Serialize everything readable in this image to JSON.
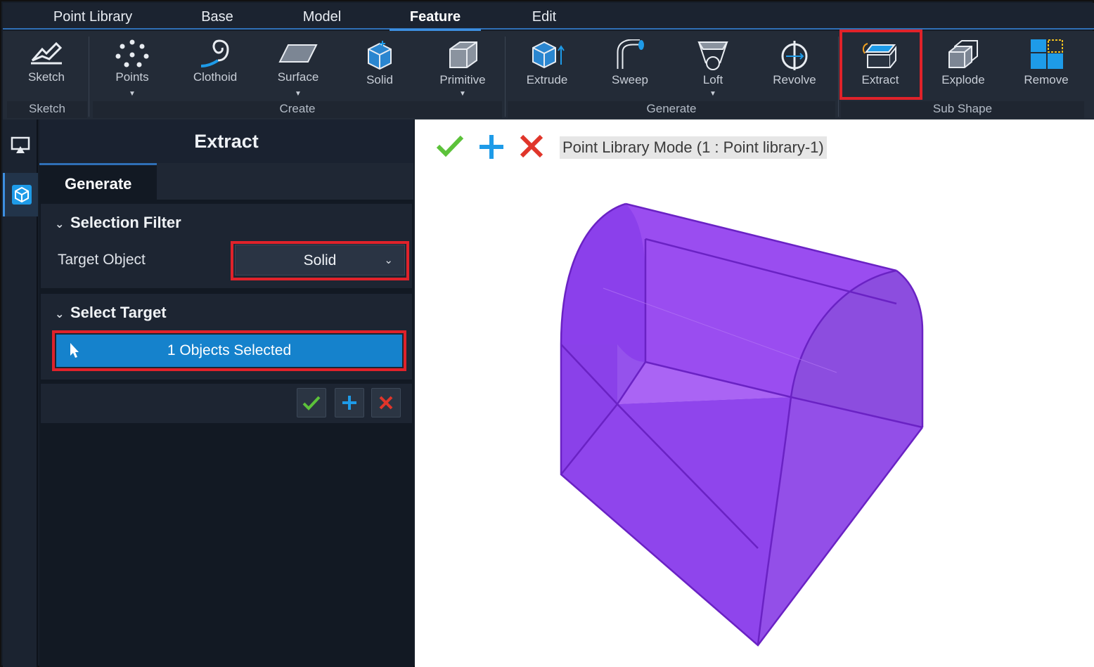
{
  "menu": {
    "tabs": [
      {
        "label": "Point Library",
        "active": false
      },
      {
        "label": "Base",
        "active": false
      },
      {
        "label": "Model",
        "active": false
      },
      {
        "label": "Feature",
        "active": true
      },
      {
        "label": "Edit",
        "active": false
      }
    ]
  },
  "ribbon": {
    "buttons": [
      {
        "label": "Sketch",
        "icon": "sketch-icon"
      },
      {
        "label": "Points",
        "icon": "points-icon",
        "dropdown": "▼"
      },
      {
        "label": "Clothoid",
        "icon": "clothoid-icon"
      },
      {
        "label": "Surface",
        "icon": "surface-icon",
        "dropdown": "▼"
      },
      {
        "label": "Solid",
        "icon": "solid-icon"
      },
      {
        "label": "Primitive",
        "icon": "primitive-icon",
        "dropdown": "▼"
      },
      {
        "label": "Extrude",
        "icon": "extrude-icon"
      },
      {
        "label": "Sweep",
        "icon": "sweep-icon"
      },
      {
        "label": "Loft",
        "icon": "loft-icon",
        "dropdown": "▼"
      },
      {
        "label": "Revolve",
        "icon": "revolve-icon"
      },
      {
        "label": "Extract",
        "icon": "extract-icon",
        "highlighted": true
      },
      {
        "label": "Explode",
        "icon": "explode-icon"
      },
      {
        "label": "Remove",
        "icon": "remove-icon"
      }
    ],
    "groups": [
      "Sketch",
      "Create",
      "Generate",
      "Sub Shape"
    ]
  },
  "sidebar": {
    "icons": [
      "display-icon",
      "cube-icon"
    ],
    "active": "cube-icon"
  },
  "panel": {
    "title": "Extract",
    "tabs": [
      "Generate"
    ],
    "selection_filter": {
      "header": "Selection Filter",
      "target_object_label": "Target Object",
      "target_object_value": "Solid",
      "dropdown_arrow": "⌄"
    },
    "select_target": {
      "header": "Select Target",
      "selection_text": "1 Objects Selected"
    },
    "actions": [
      "confirm-icon",
      "add-icon",
      "cancel-icon"
    ]
  },
  "viewport": {
    "mode_label": "Point Library Mode (1 : Point library-1)",
    "toolbar": [
      "confirm-icon",
      "add-icon",
      "cancel-icon"
    ],
    "shape_color": "#8a3fea",
    "highlight_color": "#e0222a",
    "accent_color": "#1582cc"
  },
  "chevron": "⌄"
}
